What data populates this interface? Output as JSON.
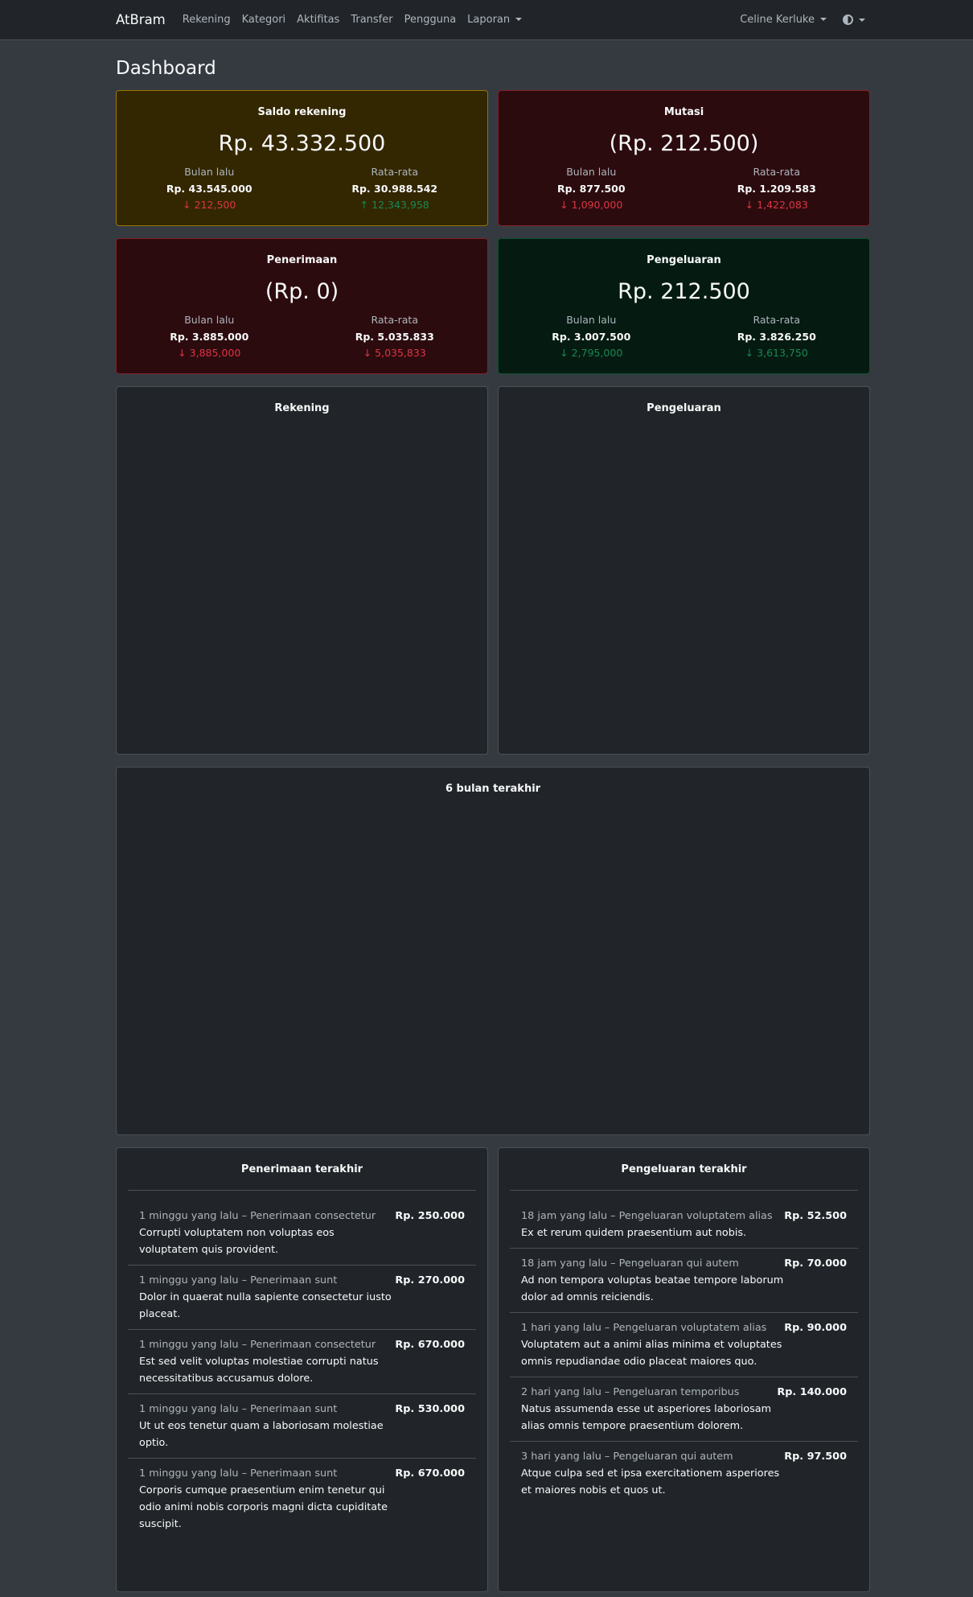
{
  "navbar": {
    "brand": "AtBram",
    "links": [
      "Rekening",
      "Kategori",
      "Aktifitas",
      "Transfer",
      "Pengguna",
      "Laporan"
    ],
    "user": "Celine Kerluke"
  },
  "page": {
    "title": "Dashboard"
  },
  "stats": [
    {
      "title": "Saldo rekening",
      "value": "Rp. 43.332.500",
      "last_label": "Bulan lalu",
      "last_value": "Rp. 43.545.000",
      "last_diff": "↓ 212,500",
      "avg_label": "Rata-rata",
      "avg_value": "Rp. 30.988.542",
      "avg_diff": "↑ 12,343,958"
    },
    {
      "title": "Mutasi",
      "value": "(Rp. 212.500)",
      "last_label": "Bulan lalu",
      "last_value": "Rp. 877.500",
      "last_diff": "↓ 1,090,000",
      "avg_label": "Rata-rata",
      "avg_value": "Rp. 1.209.583",
      "avg_diff": "↓ 1,422,083"
    },
    {
      "title": "Penerimaan",
      "value": "(Rp. 0)",
      "last_label": "Bulan lalu",
      "last_value": "Rp. 3.885.000",
      "last_diff": "↓ 3,885,000",
      "avg_label": "Rata-rata",
      "avg_value": "Rp. 5.035.833",
      "avg_diff": "↓ 5,035,833"
    },
    {
      "title": "Pengeluaran",
      "value": "Rp. 212.500",
      "last_label": "Bulan lalu",
      "last_value": "Rp. 3.007.500",
      "last_diff": "↓ 2,795,000",
      "avg_label": "Rata-rata",
      "avg_value": "Rp. 3.826.250",
      "avg_diff": "↓ 3,613,750"
    }
  ],
  "charts": {
    "rekening_title": "Rekening",
    "pengeluaran_title": "Pengeluaran",
    "six_months_title": "6 bulan terakhir"
  },
  "recent_income": {
    "title": "Penerimaan terakhir",
    "items": [
      {
        "meta": "1 minggu yang lalu – Penerimaan consectetur",
        "desc": "Corrupti voluptatem non voluptas eos voluptatem quis provident.",
        "amount": "Rp. 250.000"
      },
      {
        "meta": "1 minggu yang lalu – Penerimaan sunt",
        "desc": "Dolor in quaerat nulla sapiente consectetur iusto placeat.",
        "amount": "Rp. 270.000"
      },
      {
        "meta": "1 minggu yang lalu – Penerimaan consectetur",
        "desc": "Est sed velit voluptas molestiae corrupti natus necessitatibus accusamus dolore.",
        "amount": "Rp. 670.000"
      },
      {
        "meta": "1 minggu yang lalu – Penerimaan sunt",
        "desc": "Ut ut eos tenetur quam a laboriosam molestiae optio.",
        "amount": "Rp. 530.000"
      },
      {
        "meta": "1 minggu yang lalu – Penerimaan sunt",
        "desc": "Corporis cumque praesentium enim tenetur qui odio animi nobis corporis magni dicta cupiditate suscipit.",
        "amount": "Rp. 670.000"
      }
    ]
  },
  "recent_expense": {
    "title": "Pengeluaran terakhir",
    "items": [
      {
        "meta": "18 jam yang lalu – Pengeluaran voluptatem alias",
        "desc": "Ex et rerum quidem praesentium aut nobis.",
        "amount": "Rp. 52.500"
      },
      {
        "meta": "18 jam yang lalu – Pengeluaran qui autem",
        "desc": "Ad non tempora voluptas beatae tempore laborum dolor ad omnis reiciendis.",
        "amount": "Rp. 70.000"
      },
      {
        "meta": "1 hari yang lalu – Pengeluaran voluptatem alias",
        "desc": "Voluptatem aut a animi alias minima et voluptates omnis repudiandae odio placeat maiores quo.",
        "amount": "Rp. 90.000"
      },
      {
        "meta": "2 hari yang lalu – Pengeluaran temporibus",
        "desc": "Natus assumenda esse ut asperiores laboriosam alias omnis tempore praesentium dolorem.",
        "amount": "Rp. 140.000"
      },
      {
        "meta": "3 hari yang lalu – Pengeluaran qui autem",
        "desc": "Atque culpa sed et ipsa exercitationem asperiores et maiores nobis et quos ut.",
        "amount": "Rp. 97.500"
      }
    ]
  }
}
